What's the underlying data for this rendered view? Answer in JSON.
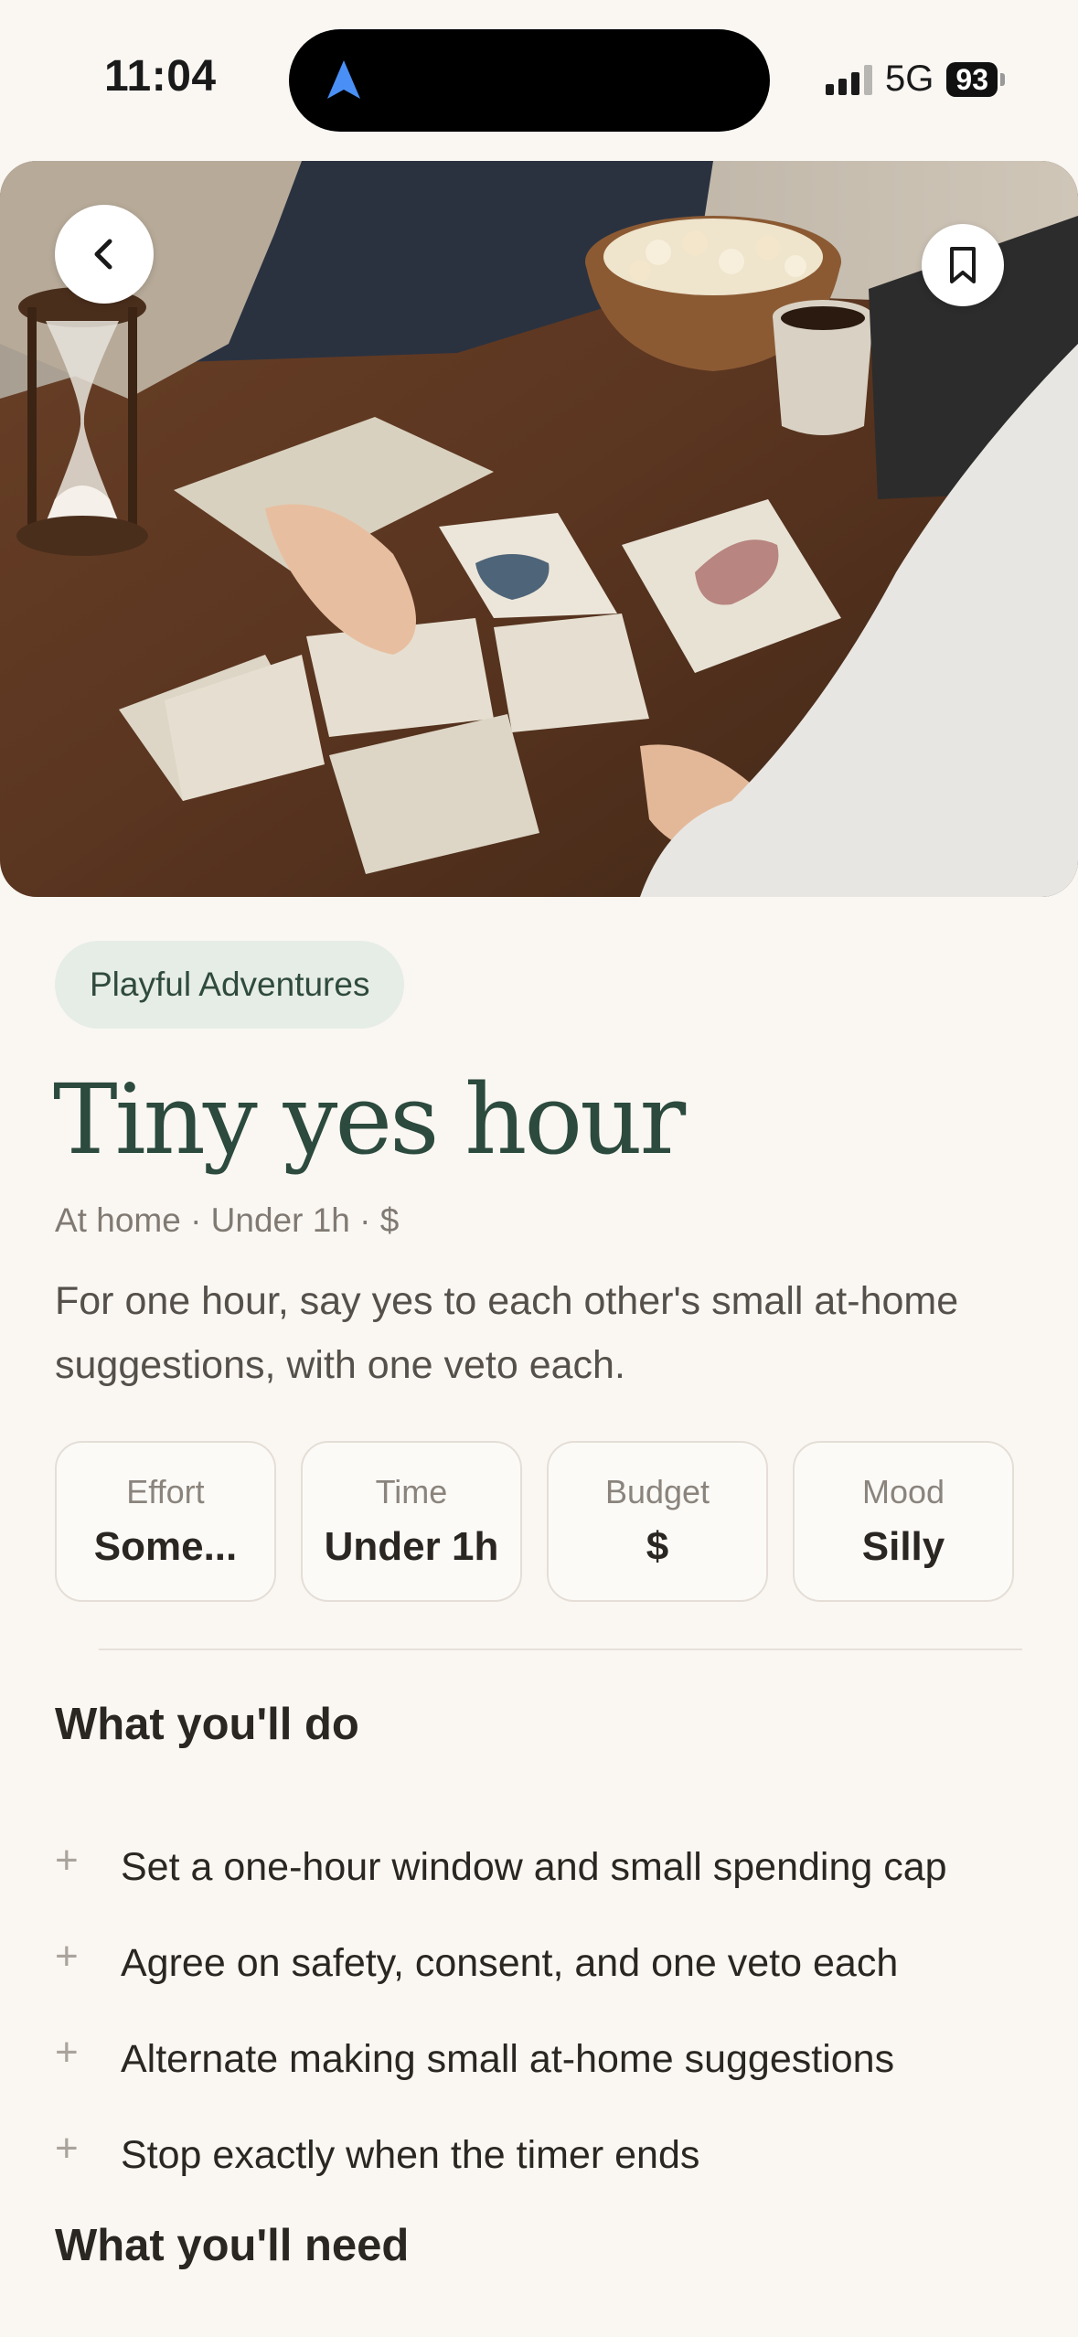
{
  "status_bar": {
    "time": "11:04",
    "network": "5G",
    "battery": "93"
  },
  "hero": {
    "image_alt": "Two people playing a card game on a wooden table with popcorn, coffee and an hourglass",
    "back_icon": "chevron-left-icon",
    "bookmark_icon": "bookmark-icon"
  },
  "activity": {
    "category": "Playful Adventures",
    "title": "Tiny yes hour",
    "meta": "At home · Under 1h · $",
    "description": "For one hour, say yes to each other's small at-home suggestions, with one veto each."
  },
  "attributes": [
    {
      "label": "Effort",
      "value": "Some..."
    },
    {
      "label": "Time",
      "value": "Under 1h"
    },
    {
      "label": "Budget",
      "value": "$"
    },
    {
      "label": "Mood",
      "value": "Silly"
    }
  ],
  "what_you_do": {
    "heading": "What you'll do",
    "steps": [
      "Set a one-hour window and small spending cap",
      "Agree on safety, consent, and one veto each",
      "Alternate making small at-home suggestions",
      "Stop exactly when the timer ends"
    ]
  },
  "what_you_need": {
    "heading": "What you'll need"
  },
  "colors": {
    "background": "#faf7f3",
    "title_green": "#2c4a3e",
    "pill_bg": "#e6ede6"
  }
}
